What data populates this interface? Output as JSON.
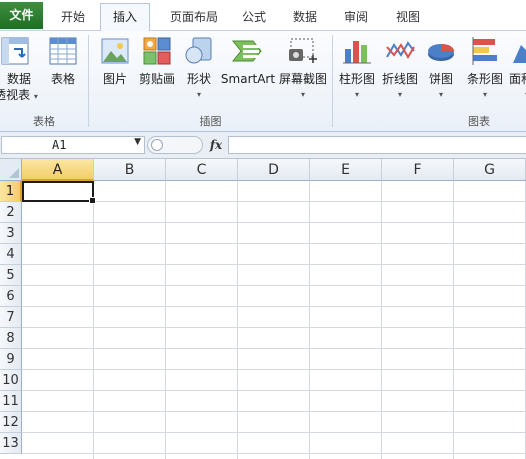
{
  "tabs": [
    {
      "label": "文件"
    },
    {
      "label": "开始"
    },
    {
      "label": "插入"
    },
    {
      "label": "页面布局"
    },
    {
      "label": "公式"
    },
    {
      "label": "数据"
    },
    {
      "label": "审阅"
    },
    {
      "label": "视图"
    }
  ],
  "active_tab": "插入",
  "ribbon": {
    "groups": [
      {
        "label": "表格"
      },
      {
        "label": "插图"
      },
      {
        "label": "图表"
      }
    ],
    "buttons": {
      "pivot_line1": "数据",
      "pivot_line2": "透视表",
      "table": "表格",
      "picture": "图片",
      "clipart": "剪贴画",
      "shapes": "形状",
      "smartart": "SmartArt",
      "screenshot": "屏幕截图",
      "column_chart": "柱形图",
      "line_chart": "折线图",
      "pie_chart": "饼图",
      "bar_chart": "条形图",
      "area_chart": "面积图"
    }
  },
  "formula_bar": {
    "name_box": "A1",
    "fx": "fx",
    "formula_value": ""
  },
  "sheet": {
    "columns": [
      "A",
      "B",
      "C",
      "D",
      "E",
      "F",
      "G"
    ],
    "rows": [
      "1",
      "2",
      "3",
      "4",
      "5",
      "6",
      "7",
      "8",
      "9",
      "10",
      "11",
      "12",
      "13"
    ],
    "selected_cell": "A1"
  },
  "colors": {
    "file_tab": "#2a7d2e",
    "selection_header": "#f4cd6a",
    "ribbon_bg": "#eaf0f8"
  }
}
